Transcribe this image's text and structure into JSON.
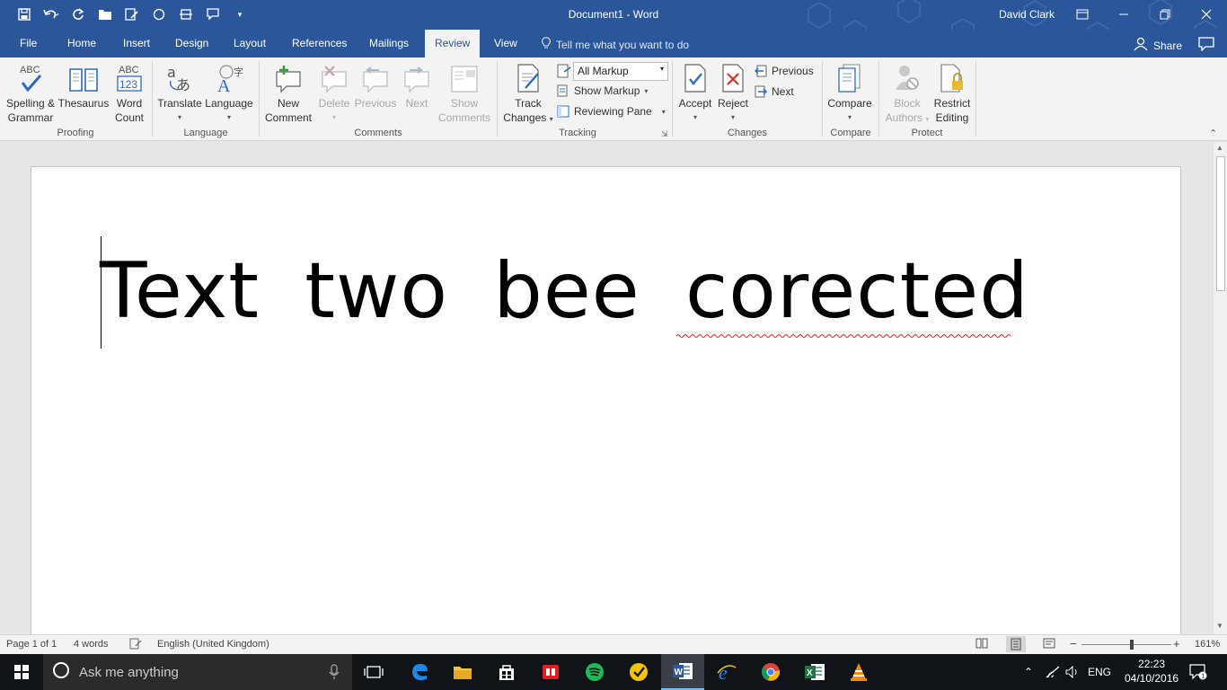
{
  "app": {
    "title": "Document1 - Word",
    "user": "David Clark"
  },
  "tabs": [
    {
      "label": "File"
    },
    {
      "label": "Home"
    },
    {
      "label": "Insert"
    },
    {
      "label": "Design"
    },
    {
      "label": "Layout"
    },
    {
      "label": "References"
    },
    {
      "label": "Mailings"
    },
    {
      "label": "Review",
      "active": true
    },
    {
      "label": "View"
    }
  ],
  "tell_me": "Tell me what you want to do",
  "share_label": "Share",
  "ribbon": {
    "proofing": {
      "spelling": "Spelling &",
      "spelling2": "Grammar",
      "thesaurus": "Thesaurus",
      "wordcount": "Word",
      "wordcount2": "Count",
      "label": "Proofing"
    },
    "language": {
      "translate": "Translate",
      "language": "Language",
      "label": "Language"
    },
    "comments": {
      "new": "New",
      "new2": "Comment",
      "delete": "Delete",
      "previous": "Previous",
      "next": "Next",
      "show": "Show",
      "show2": "Comments",
      "label": "Comments"
    },
    "tracking": {
      "track": "Track",
      "track2": "Changes",
      "markup_select": "All Markup",
      "show_markup": "Show Markup",
      "reviewing_pane": "Reviewing Pane",
      "label": "Tracking"
    },
    "changes": {
      "accept": "Accept",
      "reject": "Reject",
      "previous": "Previous",
      "next": "Next",
      "label": "Changes"
    },
    "compare": {
      "compare": "Compare",
      "label": "Compare"
    },
    "protect": {
      "block": "Block",
      "block2": "Authors",
      "restrict": "Restrict",
      "restrict2": "Editing",
      "label": "Protect"
    }
  },
  "document": {
    "text": "Text two bee corected"
  },
  "status": {
    "page": "Page 1 of 1",
    "words": "4 words",
    "language": "English (United Kingdom)",
    "zoom": "161%"
  },
  "taskbar": {
    "search_placeholder": "Ask me anything",
    "lang": "ENG",
    "time": "22:23",
    "date": "04/10/2016",
    "notifications": "1"
  },
  "colors": {
    "word_blue": "#2b579a",
    "ribbon_bg": "#f3f3f3",
    "spell_error": "#e31b1b"
  }
}
